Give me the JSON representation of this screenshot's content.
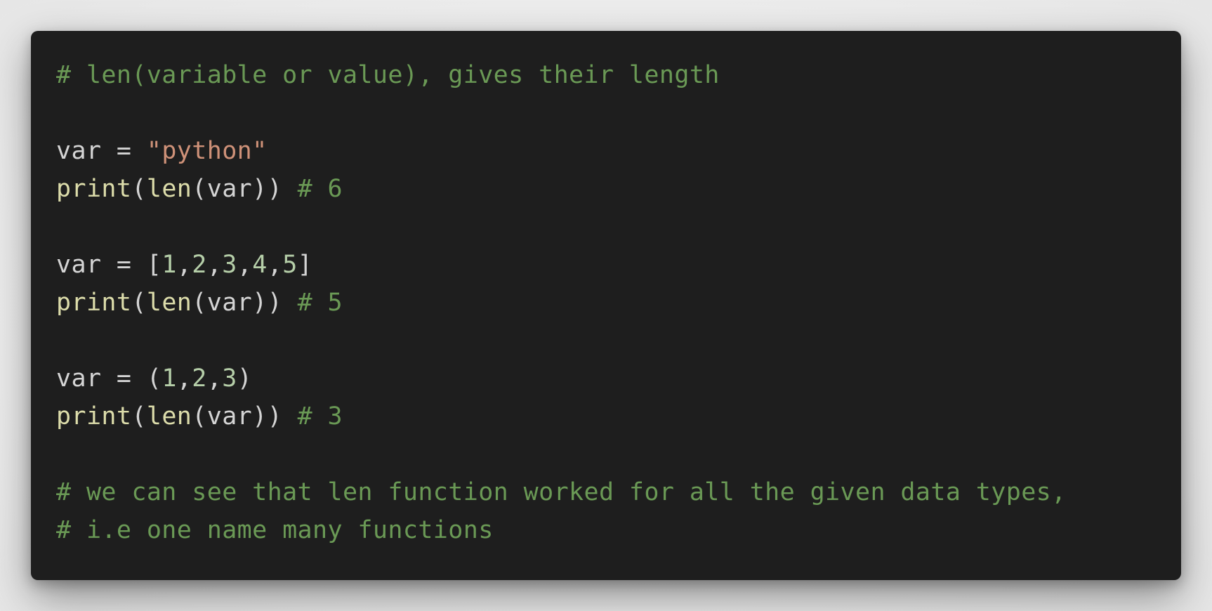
{
  "colors": {
    "background": "#ebebeb",
    "editor_bg": "#1e1e1e",
    "comment": "#6a9955",
    "plain": "#d4d4d4",
    "string": "#ce9178",
    "function": "#dcdcaa",
    "number": "#b5cea8"
  },
  "code": {
    "lines": [
      [
        {
          "t": "# len(variable or value), gives their length",
          "c": "comment"
        }
      ],
      [],
      [
        {
          "t": "var = ",
          "c": "plain"
        },
        {
          "t": "\"python\"",
          "c": "string"
        }
      ],
      [
        {
          "t": "print",
          "c": "func"
        },
        {
          "t": "(",
          "c": "plain"
        },
        {
          "t": "len",
          "c": "func"
        },
        {
          "t": "(var)) ",
          "c": "plain"
        },
        {
          "t": "# 6",
          "c": "comment"
        }
      ],
      [],
      [
        {
          "t": "var = [",
          "c": "plain"
        },
        {
          "t": "1",
          "c": "number"
        },
        {
          "t": ",",
          "c": "plain"
        },
        {
          "t": "2",
          "c": "number"
        },
        {
          "t": ",",
          "c": "plain"
        },
        {
          "t": "3",
          "c": "number"
        },
        {
          "t": ",",
          "c": "plain"
        },
        {
          "t": "4",
          "c": "number"
        },
        {
          "t": ",",
          "c": "plain"
        },
        {
          "t": "5",
          "c": "number"
        },
        {
          "t": "]",
          "c": "plain"
        }
      ],
      [
        {
          "t": "print",
          "c": "func"
        },
        {
          "t": "(",
          "c": "plain"
        },
        {
          "t": "len",
          "c": "func"
        },
        {
          "t": "(var)) ",
          "c": "plain"
        },
        {
          "t": "# 5",
          "c": "comment"
        }
      ],
      [],
      [
        {
          "t": "var = (",
          "c": "plain"
        },
        {
          "t": "1",
          "c": "number"
        },
        {
          "t": ",",
          "c": "plain"
        },
        {
          "t": "2",
          "c": "number"
        },
        {
          "t": ",",
          "c": "plain"
        },
        {
          "t": "3",
          "c": "number"
        },
        {
          "t": ")",
          "c": "plain"
        }
      ],
      [
        {
          "t": "print",
          "c": "func"
        },
        {
          "t": "(",
          "c": "plain"
        },
        {
          "t": "len",
          "c": "func"
        },
        {
          "t": "(var)) ",
          "c": "plain"
        },
        {
          "t": "# 3",
          "c": "comment"
        }
      ],
      [],
      [
        {
          "t": "# we can see that len function worked for all the given data types,",
          "c": "comment"
        }
      ],
      [
        {
          "t": "# i.e one name many functions",
          "c": "comment"
        }
      ]
    ]
  }
}
